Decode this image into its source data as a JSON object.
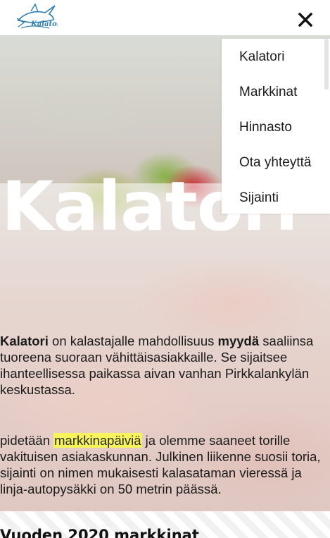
{
  "header": {
    "logo_text": "Kalatori",
    "close_icon": "close-icon"
  },
  "menu": {
    "items": [
      {
        "label": "Kalatori"
      },
      {
        "label": "Markkinat"
      },
      {
        "label": "Hinnasto"
      },
      {
        "label": "Ota yhteyttä"
      },
      {
        "label": "Sijainti"
      }
    ]
  },
  "hero": {
    "title": "Kalatori"
  },
  "intro": {
    "brand": "Kalatori",
    "text_a": " on kalastajalle mahdollisuus ",
    "strong": "myydä",
    "text_b": " saaliinsa tuoreena suoraan vähittäisasiakkaille. Se sijaitsee ihanteellisessa paikassa aivan vanhan Pirkkalankylän keskustassa."
  },
  "second": {
    "text_a": "pidetään ",
    "highlight": "markkinapäiviä",
    "text_b": " ja olemme saaneet torille vakituisen asiakaskunnan. Julkinen liikenne suosii toria, sijainti on nimen mukaisesti kalasataman vieressä ja linja-autopysäkki on 50 metrin päässä."
  },
  "section": {
    "heading": "Vuoden 2020 markkinat"
  },
  "colors": {
    "highlight": "#f6f45a",
    "logo_blue": "#2f7fb0"
  }
}
